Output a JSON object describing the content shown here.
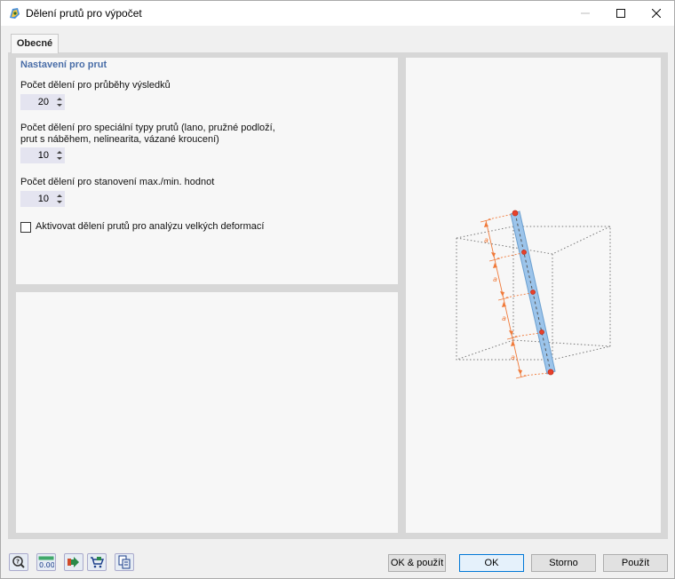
{
  "window": {
    "title": "Dělení prutů pro výpočet"
  },
  "tabs": [
    {
      "label": "Obecné",
      "active": true
    }
  ],
  "settings": {
    "section_title": "Nastavení pro prut",
    "divisions_results_label": "Počet dělení pro průběhy výsledků",
    "divisions_results_value": "20",
    "divisions_special_label_line1": "Počet dělení pro speciální typy prutů (lano, pružné podloží,",
    "divisions_special_label_line2": "prut s náběhem, nelinearita, vázané kroucení)",
    "divisions_special_value": "10",
    "divisions_maxmin_label": "Počet dělení pro stanovení max./min. hodnot",
    "divisions_maxmin_value": "10",
    "large_deformation_label": "Aktivovat dělení prutů pro analýzu velkých deformací",
    "large_deformation_checked": false
  },
  "preview": {
    "segment_label": "a",
    "member_color": "#9cc4ea",
    "node_color": "#e8402a",
    "dimension_color": "#f07a3a"
  },
  "footer": {
    "icons": [
      "help-icon",
      "units-icon",
      "arrow-export-icon",
      "cart-icon",
      "copy-icon"
    ],
    "units_icon_text": "0.00",
    "ok_apply_label": "OK & použít",
    "ok_label": "OK",
    "cancel_label": "Storno",
    "apply_label": "Použít"
  }
}
